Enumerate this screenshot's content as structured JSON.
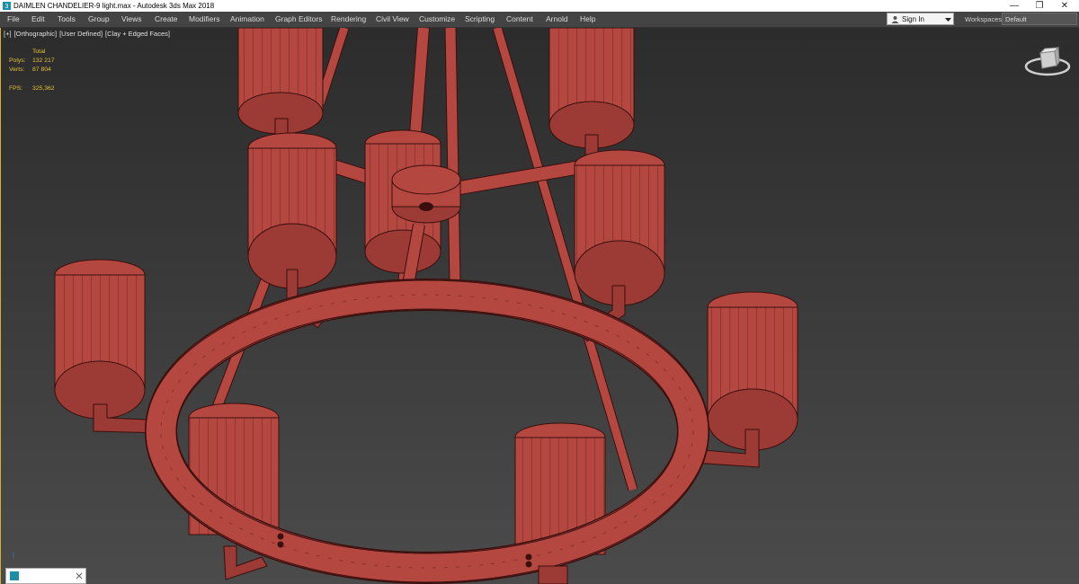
{
  "window": {
    "title": "DAIMLEN CHANDELIER-9 light.max - Autodesk 3ds Max 2018",
    "minimize_glyph": "—",
    "restore_glyph": "❐",
    "close_glyph": "✕"
  },
  "menu": {
    "items": [
      "File",
      "Edit",
      "Tools",
      "Group",
      "Views",
      "Create",
      "Modifiers",
      "Animation",
      "Graph Editors",
      "Rendering",
      "Civil View",
      "Customize",
      "Scripting",
      "Content",
      "Arnold",
      "Help"
    ]
  },
  "signin": {
    "label": "Sign In"
  },
  "workspaces": {
    "label": "Workspaces:",
    "value": "Default"
  },
  "viewport": {
    "labels": [
      "[+]",
      "[Orthographic]",
      "[User Defined]",
      "[Clay + Edged Faces]"
    ],
    "stats": {
      "header": "Total",
      "polys_label": "Polys:",
      "polys_value": "132 217",
      "verts_label": "Verts:",
      "verts_value": "87 804",
      "fps_label": "FPS:",
      "fps_value": "325,362"
    }
  },
  "colors": {
    "clay": "#b44841",
    "clay_dark": "#8a302c",
    "wire": "#3a0f0d",
    "stats_text": "#e3c237",
    "active_border": "#d8b030"
  }
}
